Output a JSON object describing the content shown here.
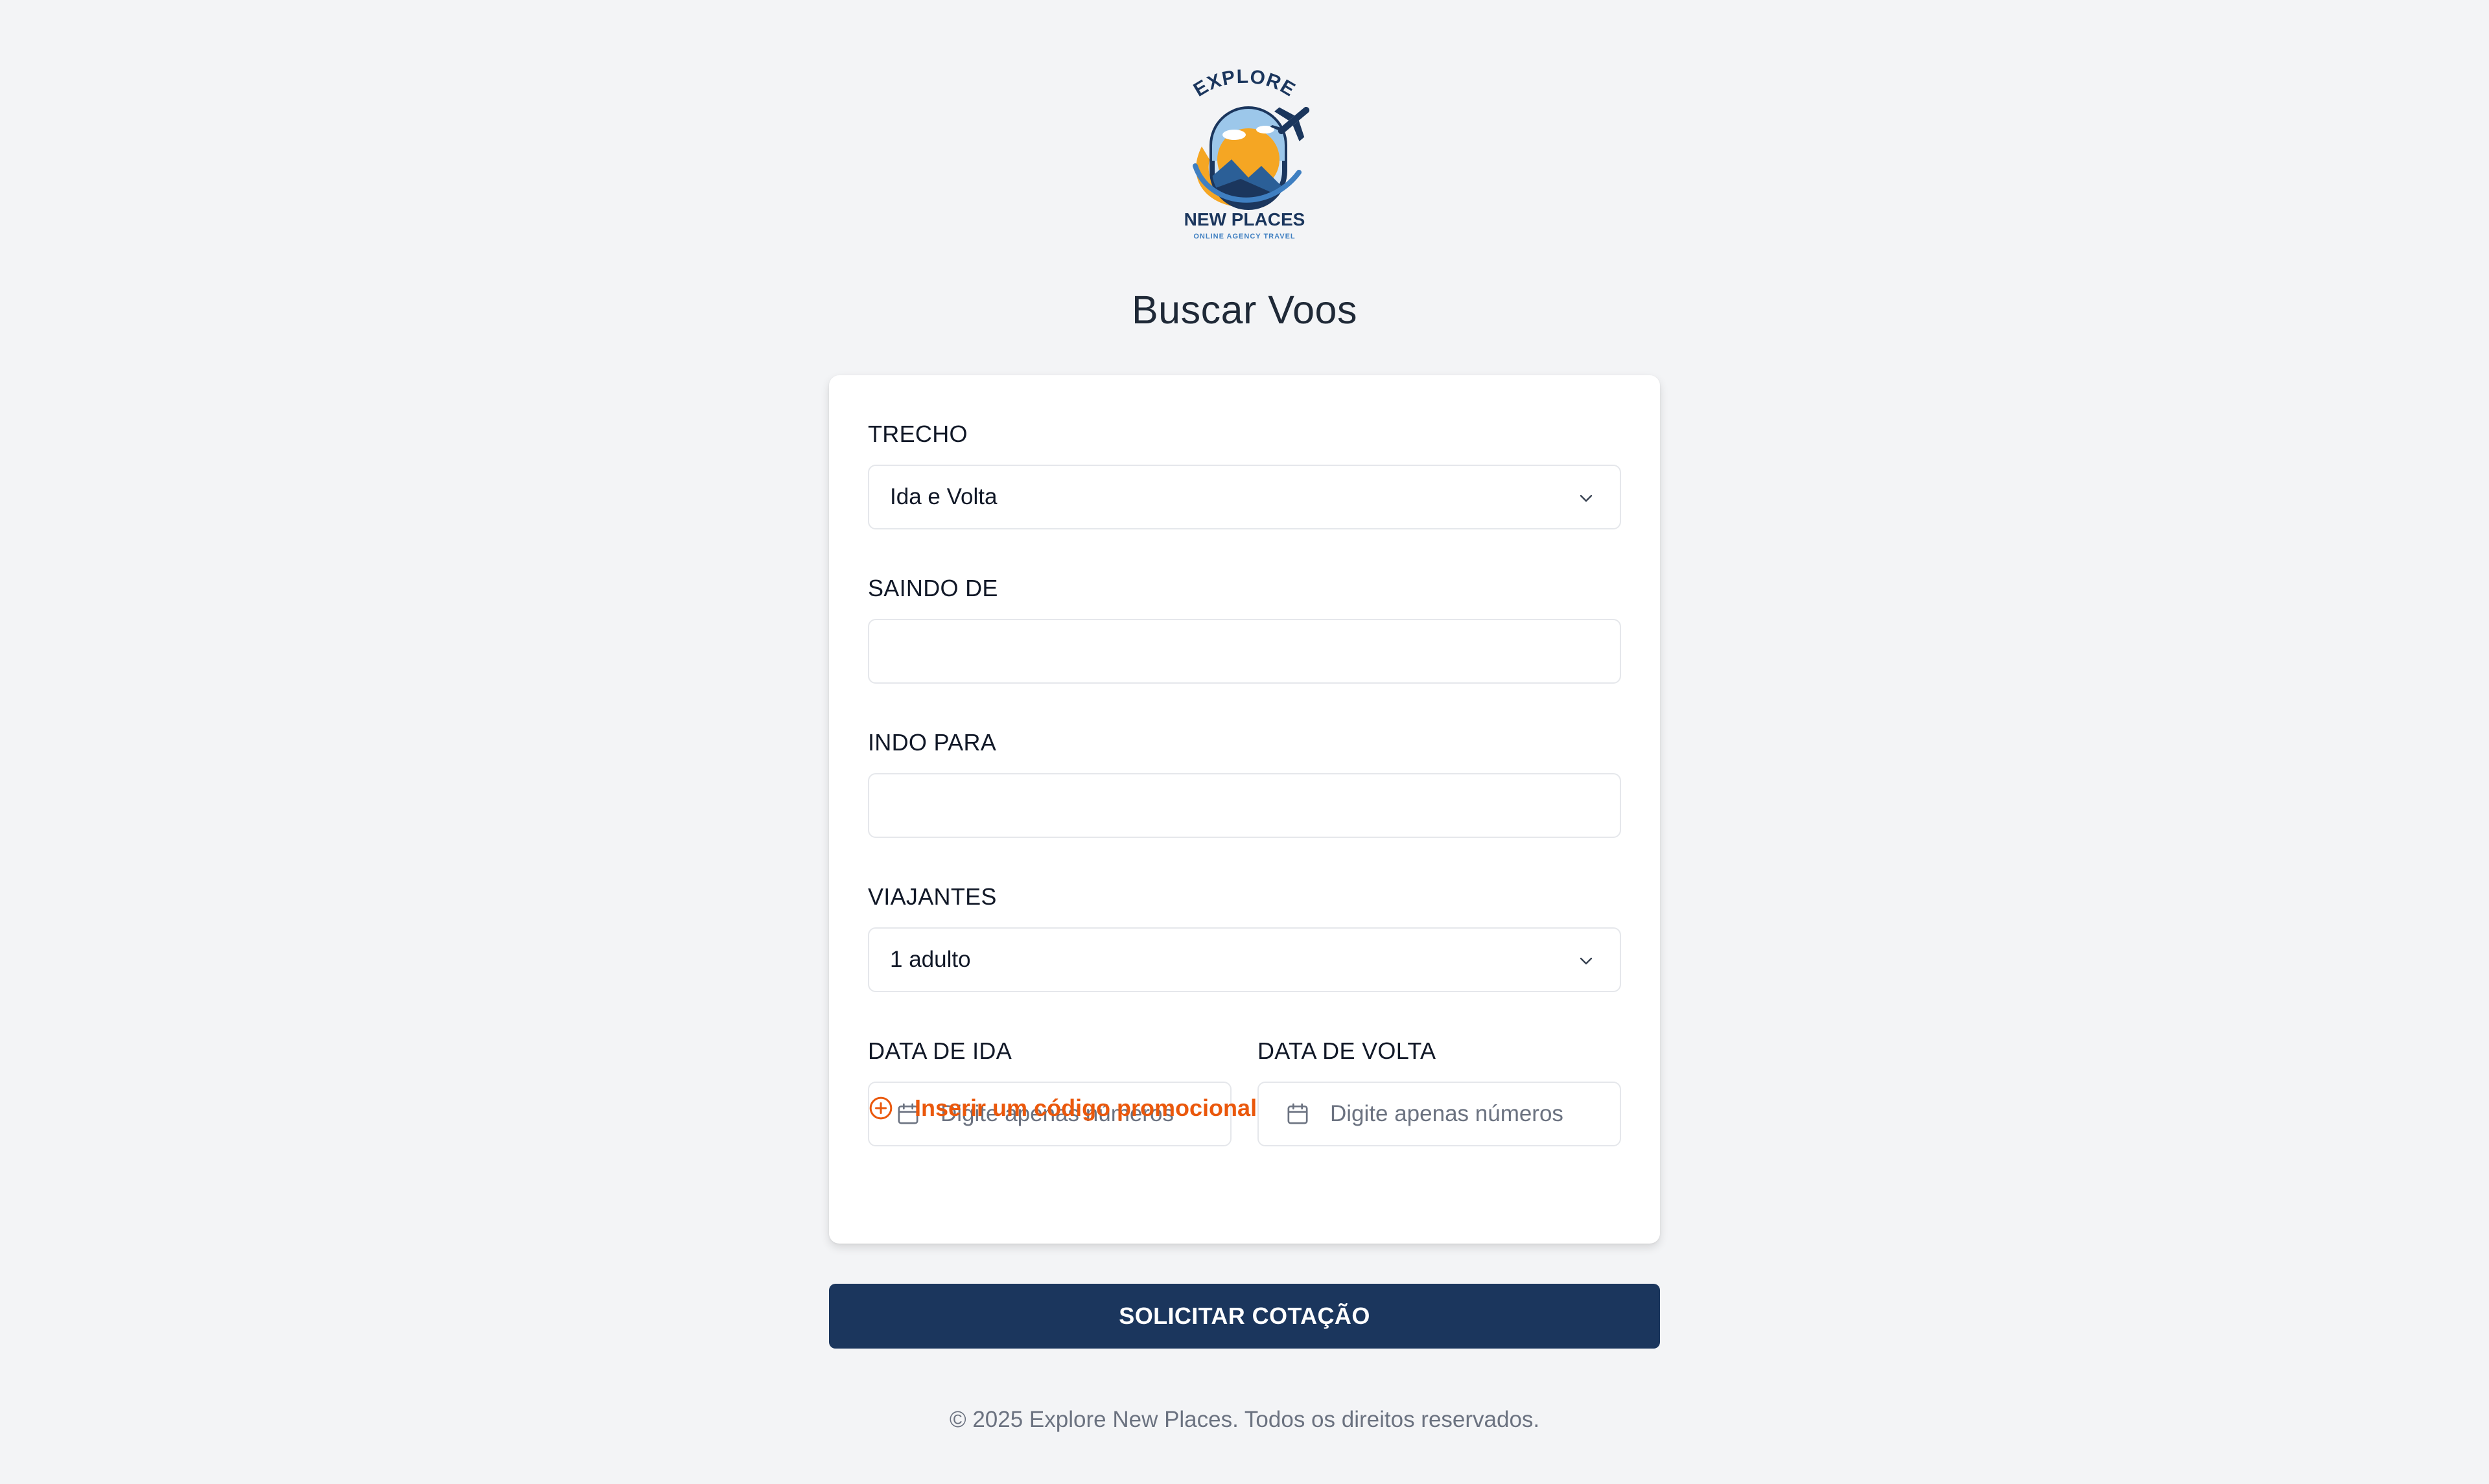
{
  "logo": {
    "brand_top": "EXPLORE",
    "brand_bottom": "NEW PLACES",
    "tagline": "ONLINE AGENCY TRAVEL",
    "colors": {
      "navy": "#1b365d",
      "orange": "#f5a623",
      "sky": "#3f7fc1"
    }
  },
  "header": {
    "title": "Buscar Voos"
  },
  "form": {
    "trecho": {
      "label": "TRECHO",
      "value": "Ida e Volta"
    },
    "saindo_de": {
      "label": "SAINDO DE",
      "value": "",
      "placeholder": ""
    },
    "indo_para": {
      "label": "INDO PARA",
      "value": "",
      "placeholder": ""
    },
    "viajantes": {
      "label": "VIAJANTES",
      "value": "1 adulto"
    },
    "data_ida": {
      "label": "DATA DE IDA",
      "placeholder": "Digite apenas números"
    },
    "data_volta": {
      "label": "DATA DE VOLTA",
      "placeholder": "Digite apenas números"
    },
    "promo": {
      "label": "Inserir um código promocional",
      "icon": "plus-circle-icon",
      "color": "#ea580c"
    }
  },
  "actions": {
    "submit_label": "SOLICITAR COTAÇÃO",
    "color": "#1b365d"
  },
  "footer": {
    "text": "© 2025 Explore New Places. Todos os direitos reservados."
  }
}
